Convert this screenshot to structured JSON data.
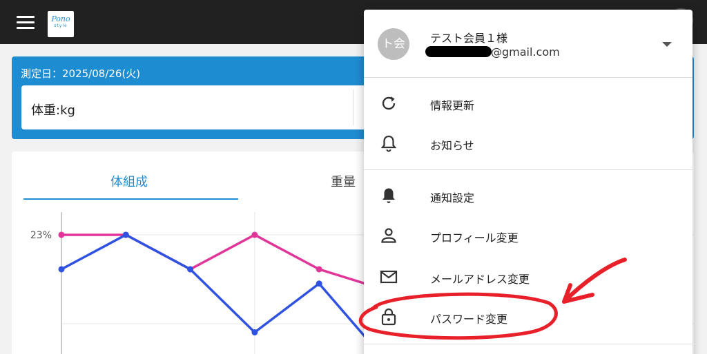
{
  "logo": {
    "main": "Pono",
    "sub": "style"
  },
  "measure": {
    "date_text": "測定日：2025/08/26(火)",
    "weight_label": "体重:kg"
  },
  "tabs": [
    {
      "label": "体組成",
      "active": true
    },
    {
      "label": "重量",
      "active": false
    }
  ],
  "chart_data": {
    "type": "line",
    "x": [
      1,
      2,
      3,
      4,
      5,
      6
    ],
    "ytick_labels": [
      "23%"
    ],
    "series": [
      {
        "color": "#e0369a",
        "values": [
          23,
          23,
          21.8,
          23,
          21.8,
          21.1
        ]
      },
      {
        "color": "#2f52e0",
        "values": [
          21.8,
          23,
          21.8,
          19.6,
          21.3,
          18.7
        ]
      }
    ],
    "ylim": [
      18.7,
      23.6
    ],
    "grid": true
  },
  "menu": {
    "avatar_text": "ト会",
    "username": "テスト会員１様",
    "email_suffix": "@gmail.com",
    "items": [
      {
        "label": "情報更新",
        "icon": "refresh-icon"
      },
      {
        "label": "お知らせ",
        "icon": "bell-outline-icon"
      },
      {
        "label": "通知設定",
        "icon": "bell-filled-icon"
      },
      {
        "label": "プロフィール変更",
        "icon": "person-icon"
      },
      {
        "label": "メールアドレス変更",
        "icon": "mail-icon"
      },
      {
        "label": "パスワード変更",
        "icon": "lock-icon"
      }
    ]
  },
  "colors": {
    "accent": "#1e8cd0",
    "topbar": "#212121",
    "annotation": "#e8202a"
  }
}
